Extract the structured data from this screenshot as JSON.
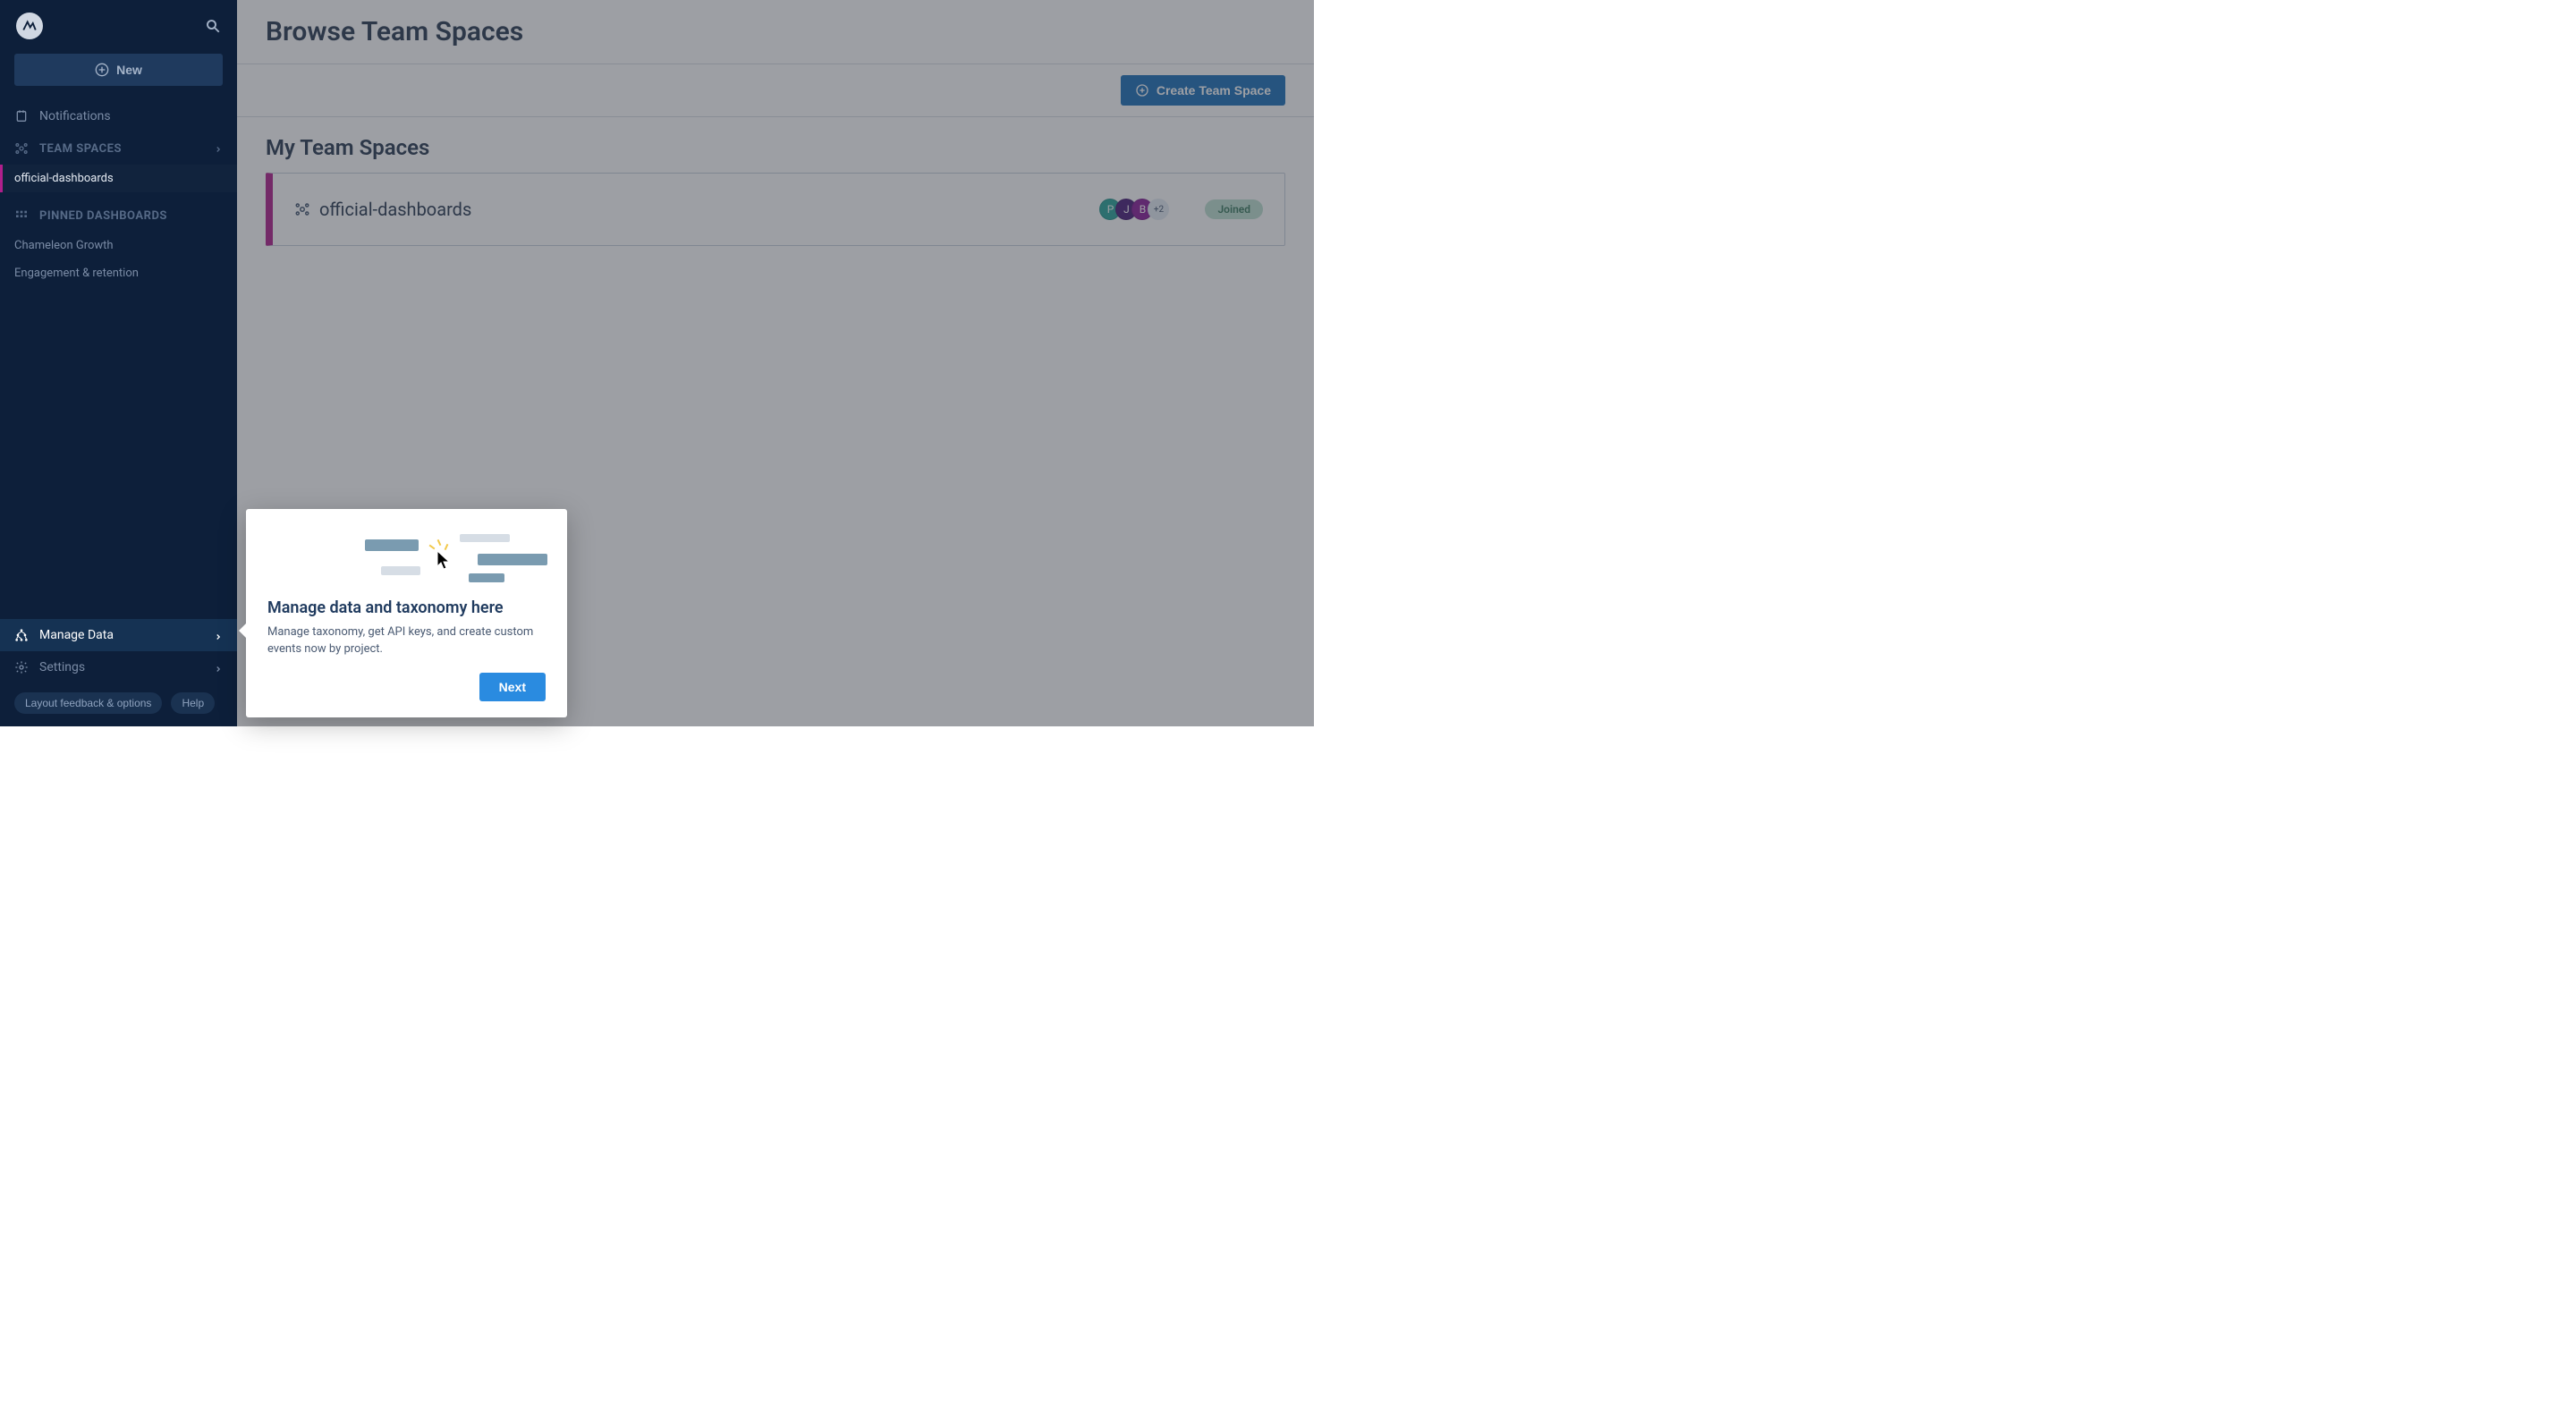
{
  "sidebar": {
    "new_label": "New",
    "notifications_label": "Notifications",
    "team_spaces_label": "TEAM SPACES",
    "team_space_items": [
      "official-dashboards"
    ],
    "pinned_label": "PINNED DASHBOARDS",
    "pinned_items": [
      "Chameleon Growth",
      "Engagement & retention"
    ],
    "manage_data_label": "Manage Data",
    "settings_label": "Settings",
    "footer_feedback": "Layout feedback & options",
    "footer_help": "Help"
  },
  "header": {
    "title": "Browse Team Spaces",
    "create_btn": "Create Team Space"
  },
  "my_spaces": {
    "title": "My Team Spaces",
    "items": [
      {
        "name": "official-dashboards",
        "avatars": [
          "P",
          "J",
          "B"
        ],
        "more": "+2",
        "status": "Joined"
      }
    ]
  },
  "tooltip": {
    "title": "Manage data and taxonomy here",
    "body": "Manage taxonomy, get API keys, and create custom events now by project.",
    "next": "Next"
  }
}
